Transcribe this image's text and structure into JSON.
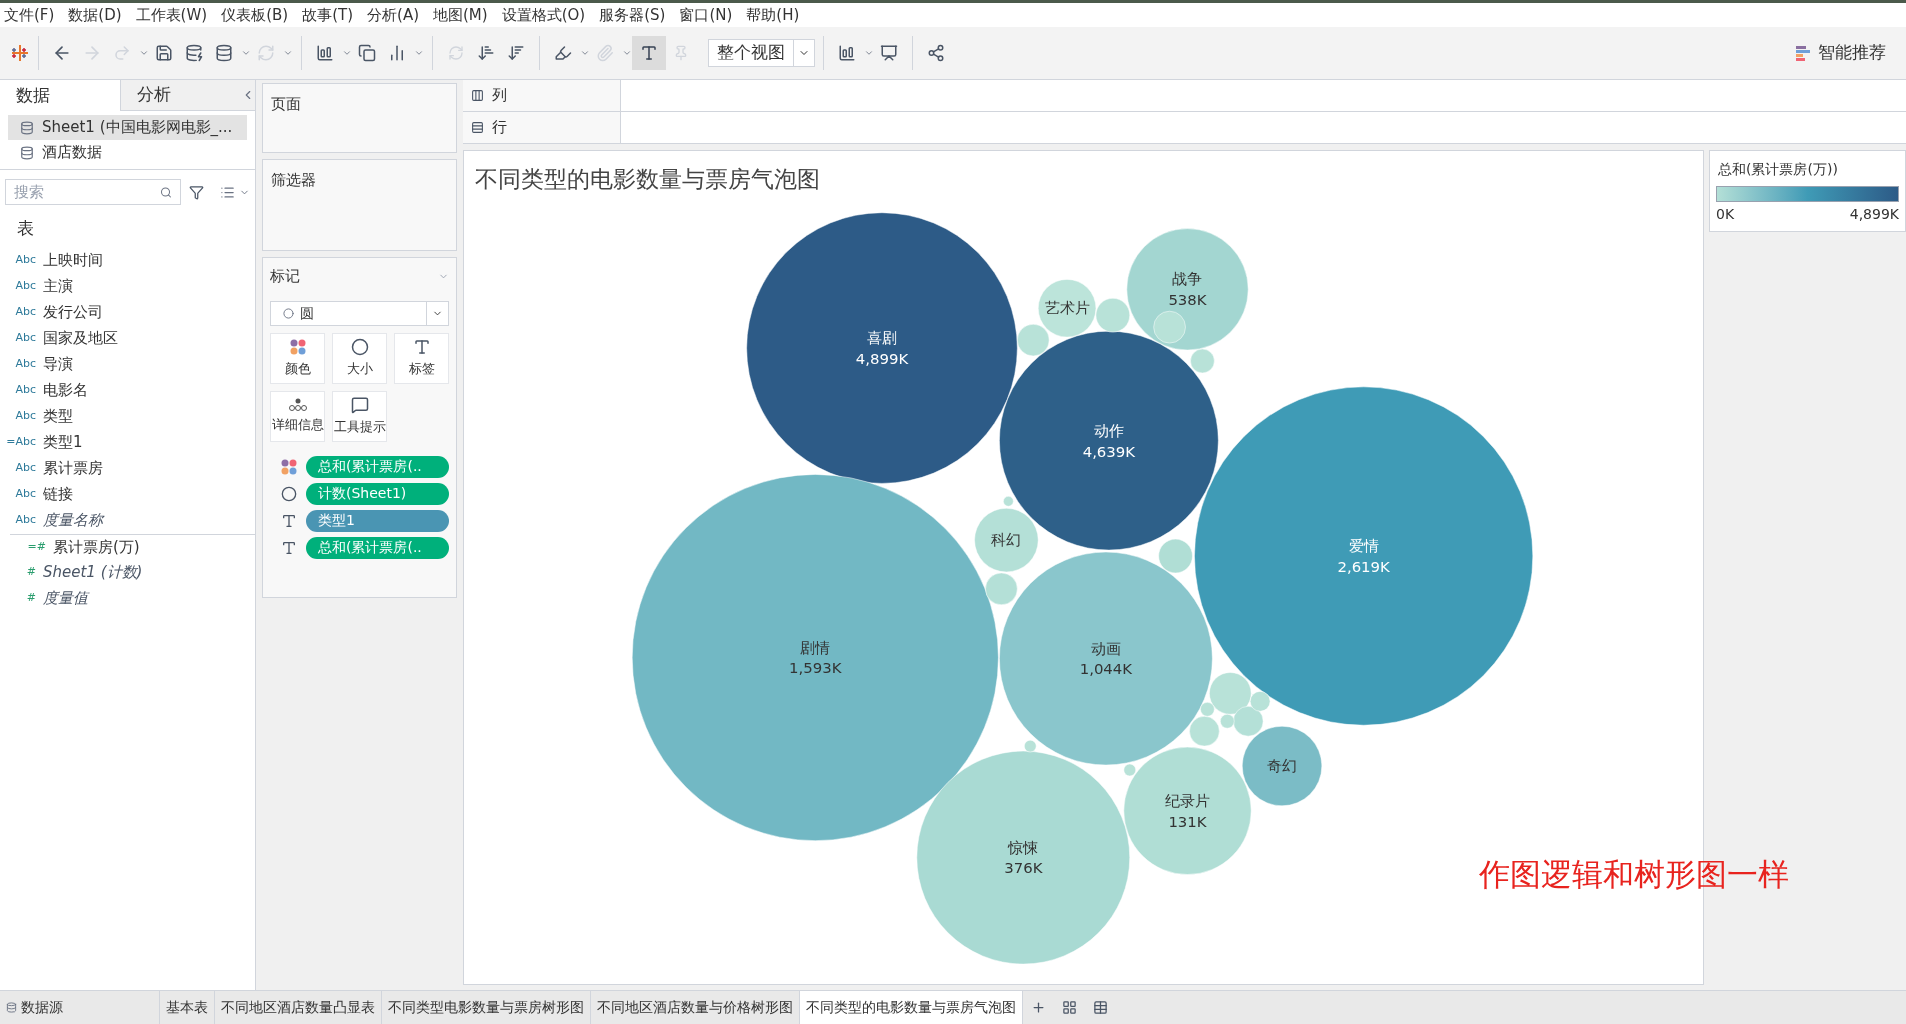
{
  "menu": [
    "文件(F)",
    "数据(D)",
    "工作表(W)",
    "仪表板(B)",
    "故事(T)",
    "分析(A)",
    "地图(M)",
    "设置格式(O)",
    "服务器(S)",
    "窗口(N)",
    "帮助(H)"
  ],
  "toolbar": {
    "show_labels": true,
    "fit": "整个视图",
    "recommend": "智能推荐"
  },
  "data_panel": {
    "tabs": [
      {
        "label": "数据",
        "selected": true
      },
      {
        "label": "分析",
        "selected": false
      }
    ],
    "sources": [
      {
        "name": "Sheet1 (中国电影网电影_...",
        "selected": true
      },
      {
        "name": "酒店数据",
        "selected": false
      }
    ],
    "search": {
      "placeholder": "搜索"
    },
    "section": "表",
    "fields": [
      {
        "type": "Abc",
        "name": "上映时间",
        "italic": false,
        "kind": "dimension"
      },
      {
        "type": "Abc",
        "name": "主演",
        "italic": false,
        "kind": "dimension"
      },
      {
        "type": "Abc",
        "name": "发行公司",
        "italic": false,
        "kind": "dimension"
      },
      {
        "type": "Abc",
        "name": "国家及地区",
        "italic": false,
        "kind": "dimension"
      },
      {
        "type": "Abc",
        "name": "导演",
        "italic": false,
        "kind": "dimension"
      },
      {
        "type": "Abc",
        "name": "电影名",
        "italic": false,
        "kind": "dimension"
      },
      {
        "type": "Abc",
        "name": "类型",
        "italic": false,
        "kind": "dimension"
      },
      {
        "type": "=Abc",
        "name": "类型1",
        "italic": false,
        "kind": "dimension"
      },
      {
        "type": "Abc",
        "name": "累计票房",
        "italic": false,
        "kind": "dimension"
      },
      {
        "type": "Abc",
        "name": "链接",
        "italic": false,
        "kind": "dimension"
      },
      {
        "type": "Abc",
        "name": "度量名称",
        "italic": true,
        "kind": "dimension"
      },
      {
        "type": "=#",
        "name": "累计票房(万)",
        "italic": false,
        "kind": "measure"
      },
      {
        "type": "#",
        "name": "Sheet1 (计数)",
        "italic": true,
        "kind": "measure"
      },
      {
        "type": "#",
        "name": "度量值",
        "italic": true,
        "kind": "measure"
      }
    ]
  },
  "pages_card": {
    "title": "页面"
  },
  "filters_card": {
    "title": "筛选器"
  },
  "marks_card": {
    "title": "标记",
    "mark_type": "圆",
    "buttons": [
      {
        "kind": "color",
        "label": "颜色"
      },
      {
        "kind": "size",
        "label": "大小"
      },
      {
        "kind": "label",
        "label": "标签"
      },
      {
        "kind": "detail",
        "label": "详细信息"
      },
      {
        "kind": "tooltip",
        "label": "工具提示"
      }
    ],
    "pills": [
      {
        "kind": "color",
        "continuous": true,
        "label": "总和(累计票房(.."
      },
      {
        "kind": "size",
        "continuous": true,
        "label": "计数(Sheet1)"
      },
      {
        "kind": "label",
        "continuous": false,
        "label": "类型1"
      },
      {
        "kind": "label",
        "continuous": true,
        "label": "总和(累计票房(.."
      }
    ]
  },
  "shelves": [
    {
      "kind": "columns",
      "label": "列"
    },
    {
      "kind": "rows",
      "label": "行"
    }
  ],
  "view": {
    "title": "不同类型的电影数量与票房气泡图",
    "bubbles": [
      {
        "label": "喜剧",
        "value": "4,899K",
        "color": "#2d5b87"
      },
      {
        "label": "动作",
        "value": "4,639K",
        "color": "#2e6089"
      },
      {
        "label": "爱情",
        "value": "2,619K",
        "color": "#3f9bb6"
      },
      {
        "label": "剧情",
        "value": "1,593K",
        "color": "#72b8c4"
      },
      {
        "label": "动画",
        "value": "1,044K",
        "color": "#8ac6cc"
      },
      {
        "label": "惊悚",
        "value": "376K",
        "color": "#a9dad3"
      },
      {
        "label": "纪录片",
        "value": "131K",
        "color": "#b0ded5"
      },
      {
        "label": "奇幻",
        "color": "#7bbcc6"
      },
      {
        "label": "科幻",
        "color": "#b4e0d7"
      },
      {
        "label": "艺术片",
        "color": "#bce4da"
      },
      {
        "label": "战争",
        "value": "538K",
        "color": "#a3d6d1"
      },
      {
        "color": "#b8e2d8"
      },
      {
        "color": "#b8e2d8"
      },
      {
        "color": "#b8e2d8"
      },
      {
        "color": "#b8e2d8"
      },
      {
        "color": "#b0ded5"
      },
      {
        "color": "#b4e0d7"
      },
      {
        "color": "#b8e2d8"
      },
      {
        "color": "#b4e0d7"
      },
      {
        "color": "#b8e2d8"
      },
      {
        "color": "#b8e2d8"
      },
      {
        "color": "#b8e2d8"
      },
      {
        "color": "#b8e2d8"
      },
      {
        "color": "#b8e2d8"
      },
      {
        "color": "#b8e2d8"
      },
      {
        "color": "#b8e2d8"
      }
    ],
    "annotation": "作图逻辑和树形图一样"
  },
  "legend": {
    "title": "总和(累计票房(万))",
    "min": "0K",
    "max": "4,899K"
  },
  "sheet_tabs": [
    {
      "label": "数据源",
      "kind": "datasource",
      "selected": false
    },
    {
      "label": "基本表",
      "kind": "sheet",
      "selected": false
    },
    {
      "label": "不同地区酒店数量凸显表",
      "kind": "sheet",
      "selected": false
    },
    {
      "label": "不同类型电影数量与票房树形图",
      "kind": "sheet",
      "selected": false
    },
    {
      "label": "不同地区酒店数量与价格树形图",
      "kind": "sheet",
      "selected": false
    },
    {
      "label": "不同类型的电影数量与票房气泡图",
      "kind": "sheet",
      "selected": true
    }
  ]
}
